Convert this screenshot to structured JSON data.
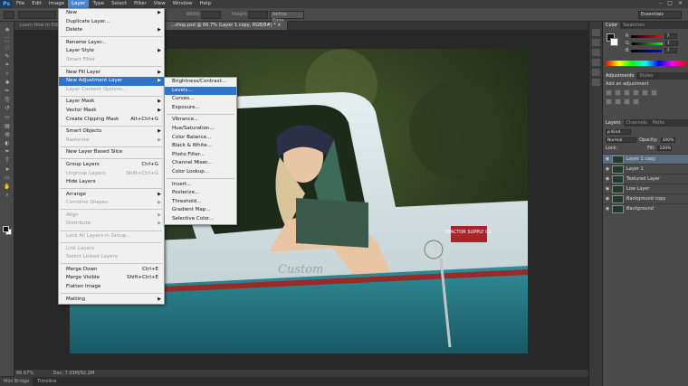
{
  "menubar": {
    "logo": "Ps",
    "items": [
      "File",
      "Edit",
      "Image",
      "Layer",
      "Type",
      "Select",
      "Filter",
      "View",
      "Window",
      "Help"
    ],
    "active_index": 3,
    "window_controls": [
      "–",
      "□",
      "×"
    ]
  },
  "optionsbar": {
    "width_label": "Width:",
    "height_label": "Height:",
    "refine_edge": "Refine Edge...",
    "workspace": "Essentials"
  },
  "tabs": [
    {
      "label": "Learn How to Edit L..."
    },
    {
      "label": "...shop.psd @ 66.7% (Layer 1 copy, RGB/8#) * ×"
    }
  ],
  "status": {
    "zoom": "66.67%",
    "doc": "Doc: 7.03M/92.2M"
  },
  "bottom_tabs": [
    "Mini Bridge",
    "Timeline"
  ],
  "layer_menu": [
    {
      "label": "New",
      "arrow": true
    },
    {
      "label": "Duplicate Layer..."
    },
    {
      "label": "Delete",
      "arrow": true
    },
    {
      "sep": true
    },
    {
      "label": "Rename Layer..."
    },
    {
      "label": "Layer Style",
      "arrow": true
    },
    {
      "label": "Smart Filter",
      "disabled": true
    },
    {
      "sep": true
    },
    {
      "label": "New Fill Layer",
      "arrow": true
    },
    {
      "label": "New Adjustment Layer",
      "arrow": true,
      "highlight": true
    },
    {
      "label": "Layer Content Options...",
      "disabled": true
    },
    {
      "sep": true
    },
    {
      "label": "Layer Mask",
      "arrow": true
    },
    {
      "label": "Vector Mask",
      "arrow": true
    },
    {
      "label": "Create Clipping Mask",
      "shortcut": "Alt+Ctrl+G"
    },
    {
      "sep": true
    },
    {
      "label": "Smart Objects",
      "arrow": true
    },
    {
      "label": "Rasterize",
      "arrow": true,
      "disabled": true
    },
    {
      "sep": true
    },
    {
      "label": "New Layer Based Slice"
    },
    {
      "sep": true
    },
    {
      "label": "Group Layers",
      "shortcut": "Ctrl+G"
    },
    {
      "label": "Ungroup Layers",
      "shortcut": "Shift+Ctrl+G",
      "disabled": true
    },
    {
      "label": "Hide Layers"
    },
    {
      "sep": true
    },
    {
      "label": "Arrange",
      "arrow": true
    },
    {
      "label": "Combine Shapes",
      "arrow": true,
      "disabled": true
    },
    {
      "sep": true
    },
    {
      "label": "Align",
      "arrow": true,
      "disabled": true
    },
    {
      "label": "Distribute",
      "arrow": true,
      "disabled": true
    },
    {
      "sep": true
    },
    {
      "label": "Lock All Layers in Group...",
      "disabled": true
    },
    {
      "sep": true
    },
    {
      "label": "Link Layers",
      "disabled": true
    },
    {
      "label": "Select Linked Layers",
      "disabled": true
    },
    {
      "sep": true
    },
    {
      "label": "Merge Down",
      "shortcut": "Ctrl+E"
    },
    {
      "label": "Merge Visible",
      "shortcut": "Shift+Ctrl+E"
    },
    {
      "label": "Flatten Image"
    },
    {
      "sep": true
    },
    {
      "label": "Matting",
      "arrow": true
    }
  ],
  "adjustment_menu": [
    {
      "label": "Brightness/Contrast..."
    },
    {
      "label": "Levels...",
      "highlight": true
    },
    {
      "label": "Curves..."
    },
    {
      "label": "Exposure..."
    },
    {
      "sep": true
    },
    {
      "label": "Vibrance..."
    },
    {
      "label": "Hue/Saturation..."
    },
    {
      "label": "Color Balance..."
    },
    {
      "label": "Black & White..."
    },
    {
      "label": "Photo Filter..."
    },
    {
      "label": "Channel Mixer..."
    },
    {
      "label": "Color Lookup..."
    },
    {
      "sep": true
    },
    {
      "label": "Invert..."
    },
    {
      "label": "Posterize..."
    },
    {
      "label": "Threshold..."
    },
    {
      "label": "Gradient Map..."
    },
    {
      "label": "Selective Color..."
    }
  ],
  "color_panel": {
    "tabs": [
      "Color",
      "Swatches"
    ],
    "rows": [
      {
        "ch": "R",
        "val": "7"
      },
      {
        "ch": "G",
        "val": "7"
      },
      {
        "ch": "B",
        "val": "7"
      }
    ]
  },
  "adjustments_panel": {
    "tabs": [
      "Adjustments",
      "Styles"
    ],
    "title": "Add an adjustment"
  },
  "layers_panel": {
    "tabs": [
      "Layers",
      "Channels",
      "Paths"
    ],
    "kind": "ρ Kind",
    "blend": "Normal",
    "opacity_label": "Opacity:",
    "opacity": "100%",
    "lock_label": "Lock:",
    "fill_label": "Fill:",
    "fill": "100%",
    "layers": [
      {
        "name": "Layer 1 copy",
        "selected": true
      },
      {
        "name": "Layer 1"
      },
      {
        "name": "Textured Layer"
      },
      {
        "name": "Low Layer"
      },
      {
        "name": "Background copy"
      },
      {
        "name": "Background",
        "italic": true
      }
    ]
  },
  "truck_badge": "TRACTOR SUPPLY CO.",
  "truck_script": "Custom",
  "colors": {
    "highlight": "#2e74c8",
    "menu_bg": "#f0f0f0",
    "ui_dark": "#282828",
    "panel": "#4a4a4a"
  }
}
